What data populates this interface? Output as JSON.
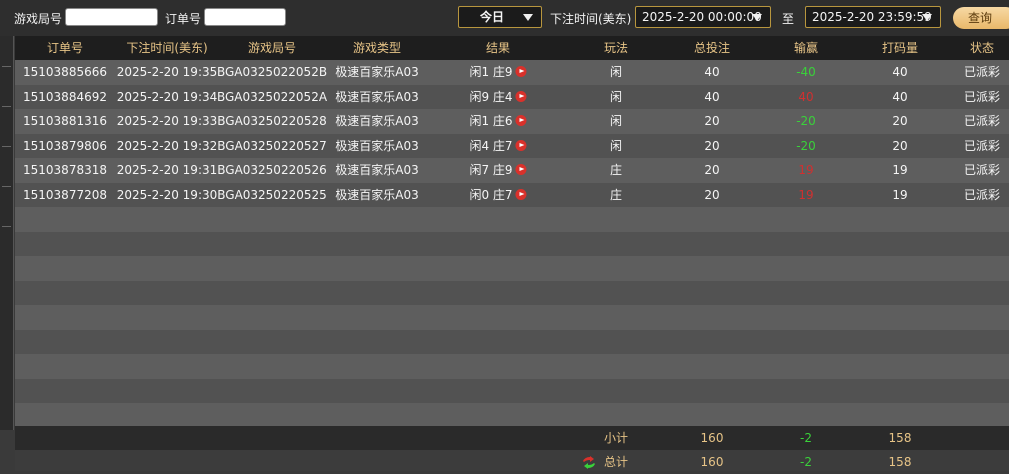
{
  "filters": {
    "game_round_label": "游戏局号",
    "order_label": "订单号",
    "period_select": "今日",
    "bet_time_label": "下注时间(美东)",
    "start_time": "2025-2-20 00:00:00",
    "to_label": "至",
    "end_time": "2025-2-20 23:59:59",
    "query_button": "查询"
  },
  "table": {
    "columns": [
      "订单号",
      "下注时间(美东)",
      "游戏局号",
      "游戏类型",
      "结果",
      "玩法",
      "总投注",
      "输赢",
      "打码量",
      "状态"
    ],
    "rows": [
      {
        "order": "15103885666",
        "time": "2025-2-20 19:35",
        "round": "BGA0325022052B",
        "game": "极速百家乐A03",
        "result": "闲1 庄9",
        "play": "闲",
        "bet": "40",
        "win": "-40",
        "win_color": "green",
        "code": "40",
        "status": "已派彩"
      },
      {
        "order": "15103884692",
        "time": "2025-2-20 19:34",
        "round": "BGA0325022052A",
        "game": "极速百家乐A03",
        "result": "闲9 庄4",
        "play": "闲",
        "bet": "40",
        "win": "40",
        "win_color": "red",
        "code": "40",
        "status": "已派彩"
      },
      {
        "order": "15103881316",
        "time": "2025-2-20 19:33",
        "round": "BGA03250220528",
        "game": "极速百家乐A03",
        "result": "闲1 庄6",
        "play": "闲",
        "bet": "20",
        "win": "-20",
        "win_color": "green",
        "code": "20",
        "status": "已派彩"
      },
      {
        "order": "15103879806",
        "time": "2025-2-20 19:32",
        "round": "BGA03250220527",
        "game": "极速百家乐A03",
        "result": "闲4 庄7",
        "play": "闲",
        "bet": "20",
        "win": "-20",
        "win_color": "green",
        "code": "20",
        "status": "已派彩"
      },
      {
        "order": "15103878318",
        "time": "2025-2-20 19:31",
        "round": "BGA03250220526",
        "game": "极速百家乐A03",
        "result": "闲7 庄9",
        "play": "庄",
        "bet": "20",
        "win": "19",
        "win_color": "red",
        "code": "19",
        "status": "已派彩"
      },
      {
        "order": "15103877208",
        "time": "2025-2-20 19:30",
        "round": "BGA03250220525",
        "game": "极速百家乐A03",
        "result": "闲0 庄7",
        "play": "庄",
        "bet": "20",
        "win": "19",
        "win_color": "red",
        "code": "19",
        "status": "已派彩"
      }
    ]
  },
  "subtotal": {
    "label": "小计",
    "bet": "160",
    "win": "-2",
    "code": "158"
  },
  "total": {
    "label": "总计",
    "bet": "160",
    "win": "-2",
    "code": "158"
  },
  "icons": {
    "result_play": "play-icon",
    "refresh": "refresh-icon",
    "dropdown": "chevron-down-icon"
  },
  "colors": {
    "accent_gold": "#e7c487",
    "win_green": "#3ad13a",
    "loss_red": "#d03030",
    "button_gold": "#e9b86a"
  }
}
